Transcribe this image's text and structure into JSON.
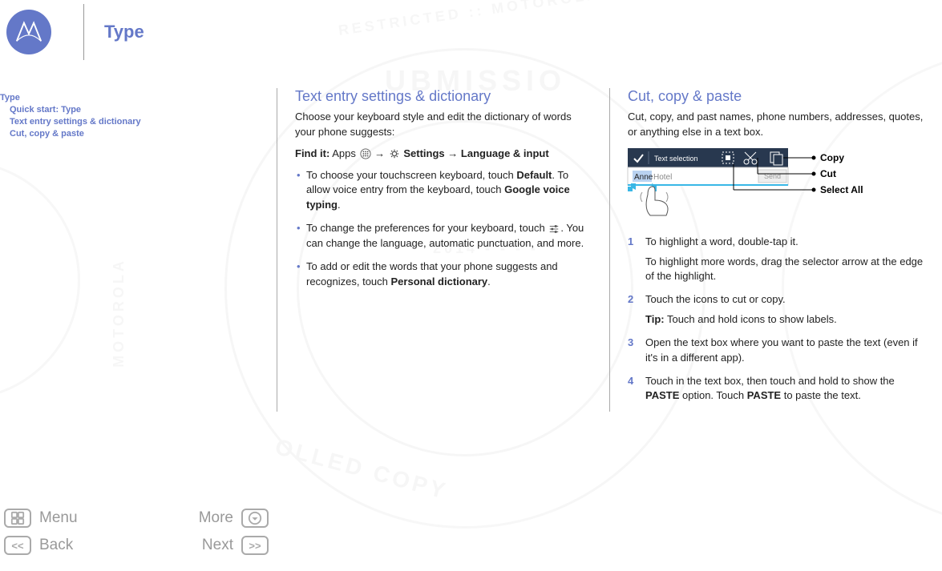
{
  "header": {
    "title": "Type"
  },
  "sidebar": {
    "heading": "Type",
    "items": [
      {
        "label": "Quick start: Type"
      },
      {
        "label": "Text entry settings & dictionary"
      },
      {
        "label": "Cut, copy & paste"
      }
    ]
  },
  "col1": {
    "title": "Text entry settings & dictionary",
    "intro": "Choose your keyboard style and edit the dictionary of words your phone suggests:",
    "findit_label": "Find it:",
    "findit_apps": "Apps",
    "findit_settings": "Settings",
    "findit_path_tail": "Language & input",
    "arrow": "→",
    "bullets": {
      "b1_pre": "To choose your touchscreen keyboard, touch ",
      "b1_default": "Default",
      "b1_mid": ". To allow voice entry from the keyboard, touch ",
      "b1_gvt": "Google voice typing",
      "b1_end": ".",
      "b2_pre": "To change the preferences for your keyboard, touch ",
      "b2_post": ". You can change the language, automatic punctuation, and more.",
      "b3_pre": "To add or edit the words that your phone suggests and recognizes, touch ",
      "b3_pd": "Personal dictionary",
      "b3_end": "."
    }
  },
  "col2": {
    "title": "Cut, copy & paste",
    "intro": "Cut, copy, and past names, phone numbers, addresses, quotes, or anything else in a text box.",
    "diagram": {
      "bar_title": "Text selection",
      "input_sel": "Anne",
      "input_rest": " Hotel",
      "send": "Send",
      "copy": "Copy",
      "cut": "Cut",
      "select_all": "Select All"
    },
    "steps": {
      "s1": "To highlight a word, double-tap it.",
      "s1b": "To highlight more words, drag the selector arrow at the edge of the highlight.",
      "s2": "Touch the icons to cut or copy.",
      "s2tip_label": "Tip:",
      "s2tip": " Touch and hold icons to show labels.",
      "s3": "Open the text box where you want to paste the text (even if it's in a different app).",
      "s4_pre": "Touch in the text box, then touch and hold to show the ",
      "s4_paste": "PASTE",
      "s4_mid": " option. Touch ",
      "s4_end": " to paste the text."
    }
  },
  "nav": {
    "menu": "Menu",
    "more": "More",
    "back": "Back",
    "next": "Next",
    "back_glyph": "<<",
    "next_glyph": ">>"
  }
}
